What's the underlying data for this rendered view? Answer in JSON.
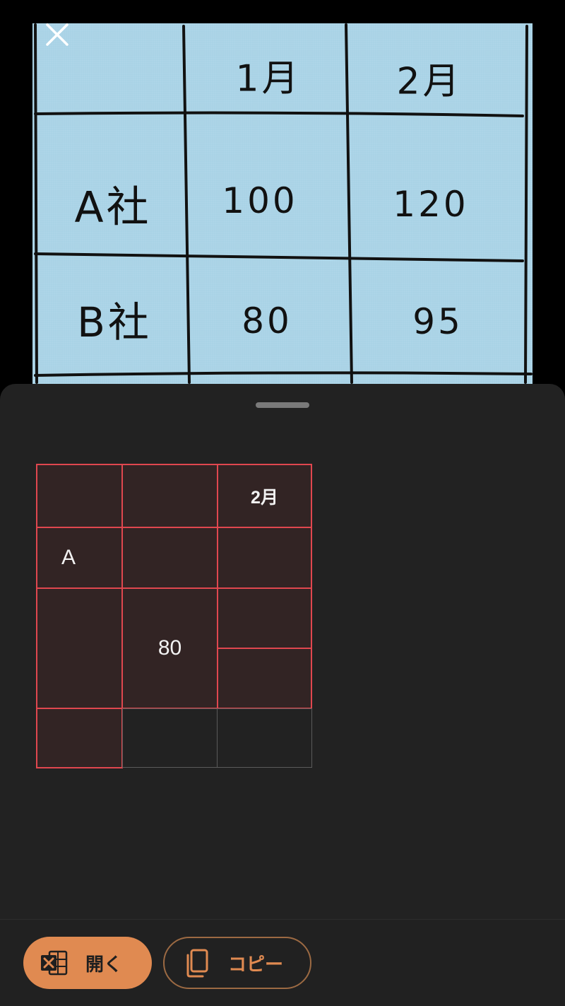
{
  "photo": {
    "header": [
      "",
      "1月",
      "2月"
    ],
    "rows": [
      [
        "A社",
        "100",
        "120"
      ],
      [
        "B社",
        "80",
        "95"
      ]
    ]
  },
  "result_table": {
    "row1": {
      "c3": "2月"
    },
    "row2": {
      "c1": "A"
    },
    "row3": {
      "c2": "80"
    }
  },
  "buttons": {
    "open_label": "開く",
    "copy_label": "コピー"
  },
  "colors": {
    "accent": "#e08a51",
    "highlight_border": "#e0474f",
    "highlight_fill": "#322424",
    "sheet_bg": "#222222",
    "photo_bg": "#a9d3e6"
  },
  "icons": {
    "close": "close-icon",
    "excel": "excel-icon",
    "copy": "copy-icon"
  }
}
